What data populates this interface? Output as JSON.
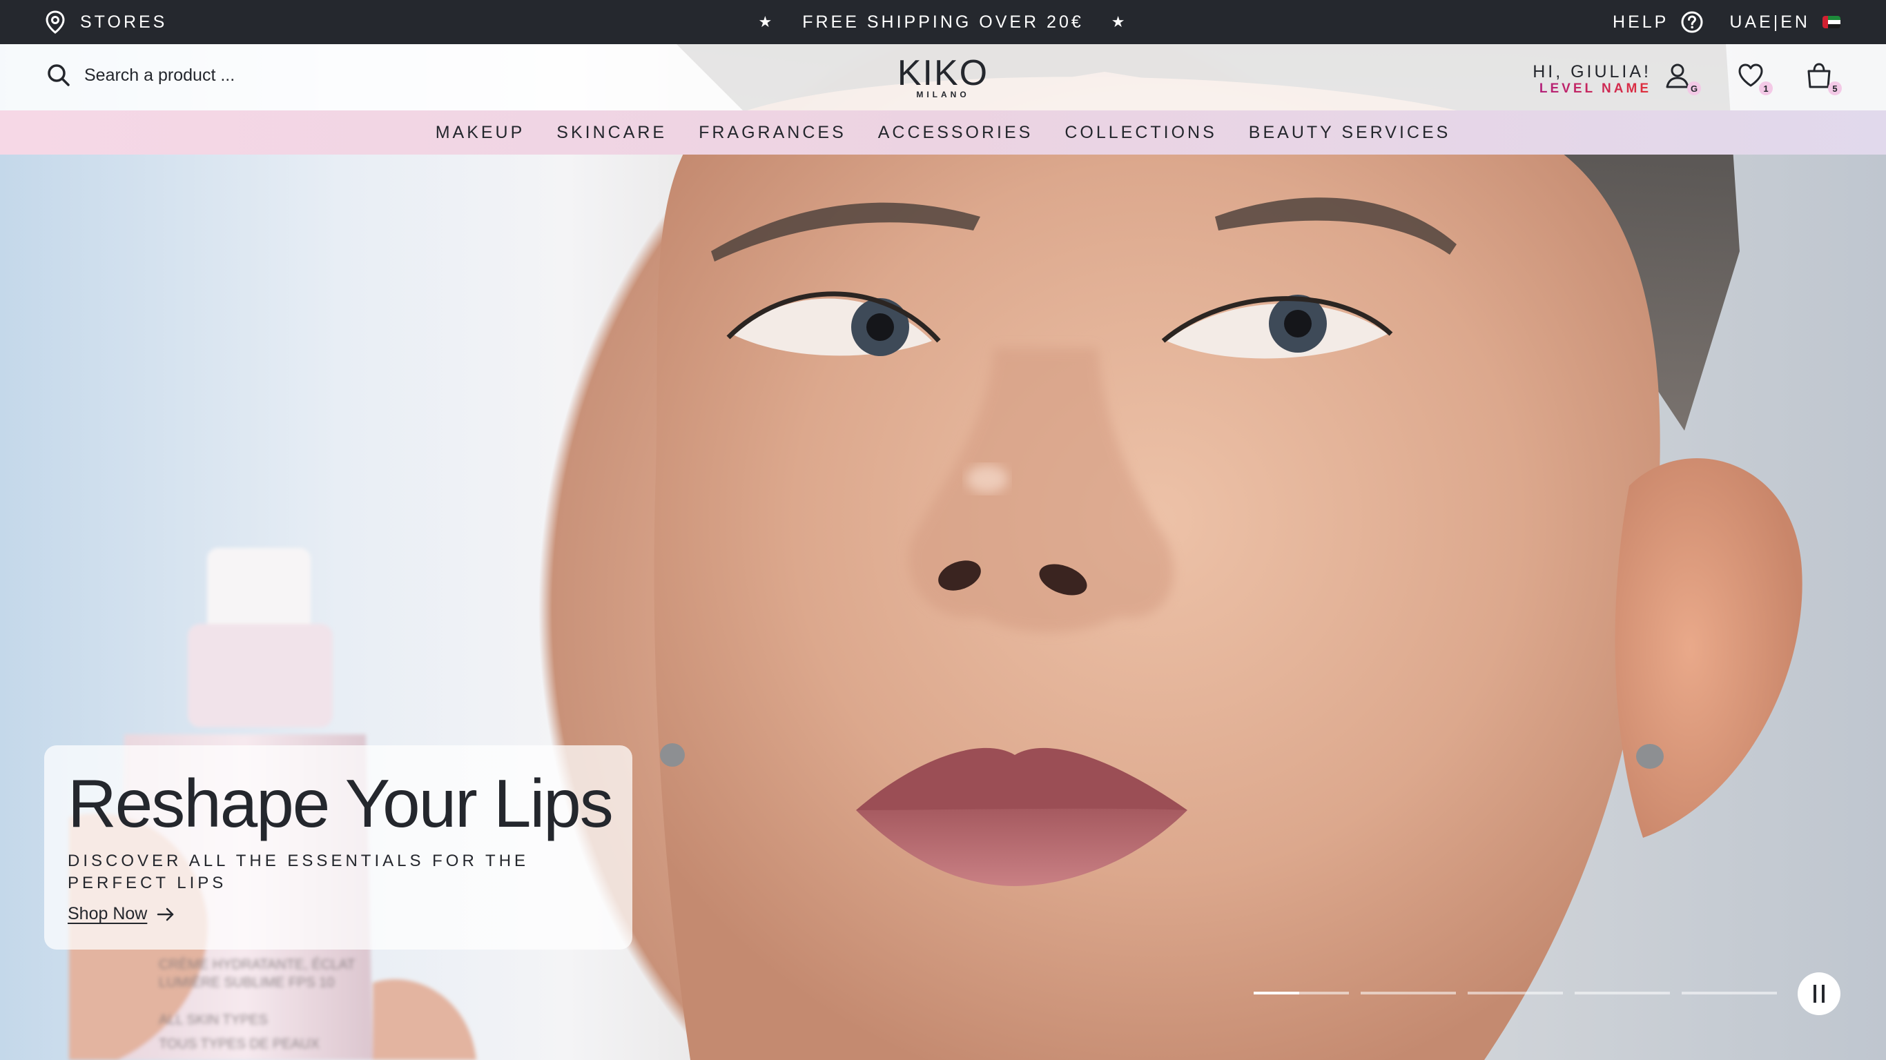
{
  "topbar": {
    "stores_label": "STORES",
    "shipping_text": "FREE SHIPPING OVER 20€",
    "help_label": "HELP",
    "locale_label": "UAE|EN"
  },
  "header": {
    "search_placeholder": "Search a product ...",
    "logo_main": "KIKO",
    "logo_sub": "MILANO",
    "greeting": "HI, GIULIA!",
    "level_name": "LEVEL NAME",
    "account_badge": "G",
    "wishlist_count": "1",
    "cart_count": "5"
  },
  "nav": {
    "items": [
      "MAKEUP",
      "SKINCARE",
      "FRAGRANCES",
      "ACCESSORIES",
      "COLLECTIONS",
      "BEAUTY SERVICES"
    ]
  },
  "hero": {
    "title": "Reshape Your Lips",
    "description": "DISCOVER ALL THE ESSENTIALS FOR THE PERFECT LIPS",
    "cta_label": "Shop Now",
    "slide_count": 5,
    "active_slide": 1,
    "bottle_text_1": "CRÈME HYDRATANTE, ÉCLAT",
    "bottle_text_2": "LUMIÈRE SUBLIME FPS 10",
    "bottle_text_3": "ALL SKIN TYPES",
    "bottle_text_4": "TOUS TYPES DE PEAUX"
  },
  "colors": {
    "topbar_bg": "#25282e",
    "text": "#24272d",
    "badge_bg": "#f3c9e6",
    "level_gradient_start": "#b0207e",
    "level_gradient_end": "#e0303a"
  },
  "icons": [
    "location-pin-icon",
    "star-icon",
    "help-circle-icon",
    "uae-flag-icon",
    "search-icon",
    "user-icon",
    "heart-icon",
    "bag-icon",
    "arrow-right-icon",
    "pause-icon"
  ]
}
